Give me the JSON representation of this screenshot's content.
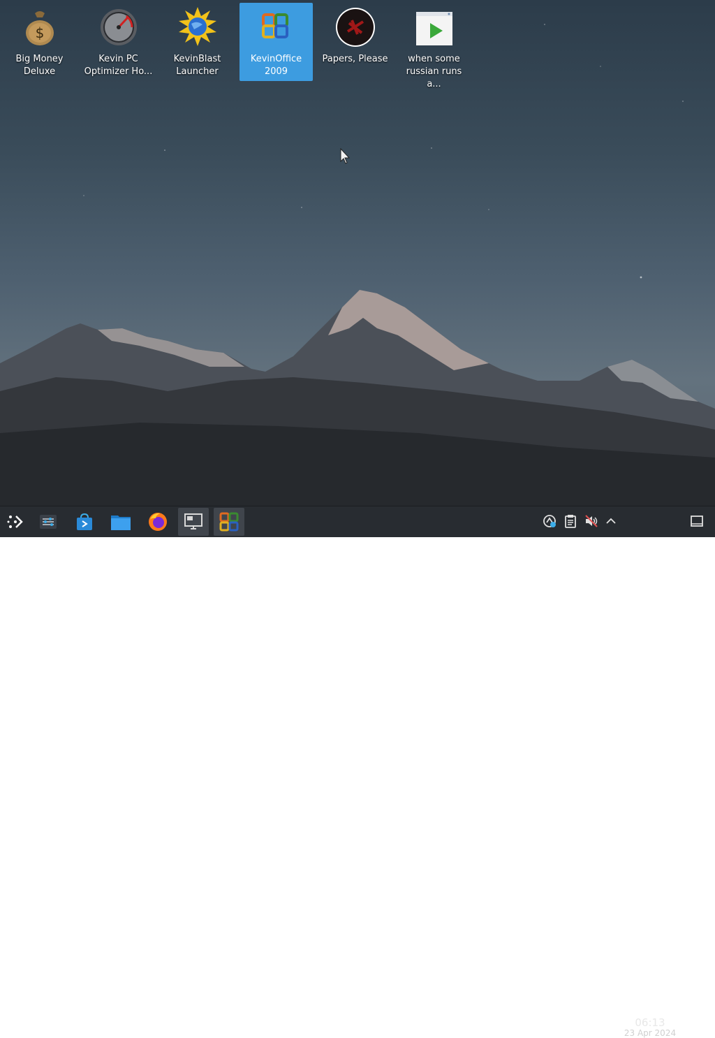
{
  "desktop_icons": [
    {
      "icon": "money-bag-icon",
      "label": "Big Money Deluxe",
      "selected": false
    },
    {
      "icon": "speedometer-icon",
      "label": "Kevin PC Optimizer Ho...",
      "selected": false
    },
    {
      "icon": "globe-burst-icon",
      "label": "KevinBlast Launcher",
      "selected": false
    },
    {
      "icon": "office-logo-icon",
      "label": "KevinOffice 2009",
      "selected": true
    },
    {
      "icon": "papers-please-icon",
      "label": "Papers, Please",
      "selected": false
    },
    {
      "icon": "video-window-icon",
      "label": "when some russian runs a...",
      "selected": false
    }
  ],
  "taskbar": {
    "launchers": [
      {
        "icon": "app-launcher-icon"
      },
      {
        "icon": "system-settings-icon"
      },
      {
        "icon": "discover-store-icon"
      },
      {
        "icon": "file-manager-icon"
      },
      {
        "icon": "firefox-icon"
      },
      {
        "icon": "remote-desktop-icon",
        "active": true
      },
      {
        "icon": "kevinoffice-task-icon",
        "active": true
      }
    ],
    "tray": [
      "network-icon",
      "clipboard-icon",
      "volume-muted-icon",
      "expand-tray-icon"
    ],
    "clock": {
      "time": "06:13",
      "date": "23 Apr 2024"
    },
    "show_desktop": "show-desktop-icon"
  },
  "colors": {
    "taskbar": "#282c31",
    "selection": "#3d9ce0",
    "sky_top": "#2c3c4a",
    "sky_mid": "#63727e"
  }
}
